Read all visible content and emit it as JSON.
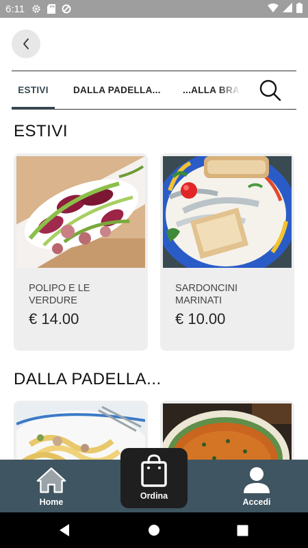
{
  "status_bar": {
    "time": "6:11",
    "icons": [
      "gear-icon",
      "sd-card-icon",
      "blocked-icon",
      "wifi-icon",
      "signal-icon",
      "battery-icon"
    ]
  },
  "header": {
    "back_icon": "chevron-left-icon"
  },
  "tabs": [
    {
      "label": "ESTIVI",
      "active": true
    },
    {
      "label": "DALLA PADELLA...",
      "active": false
    },
    {
      "label": "...ALLA BRACE",
      "active": false
    }
  ],
  "search_icon": "search-icon",
  "sections": [
    {
      "title": "ESTIVI",
      "items": [
        {
          "name": "POLIPO E LE VERDURE",
          "price": "€ 14.00"
        },
        {
          "name": "SARDONCINI MARINATI",
          "price": "€ 10.00"
        }
      ]
    },
    {
      "title": "DALLA PADELLA...",
      "items": [
        {
          "name": "",
          "price": ""
        },
        {
          "name": "",
          "price": ""
        }
      ]
    }
  ],
  "bottom_nav": {
    "home": {
      "label": "Home",
      "icon": "home-icon"
    },
    "order": {
      "label": "Ordina",
      "icon": "shopping-bag-icon"
    },
    "login": {
      "label": "Accedi",
      "icon": "user-icon"
    }
  },
  "colors": {
    "nav_bg": "#3f5561",
    "order_bg": "#1f1f1f",
    "card_bg": "#eeeeee",
    "tab_active": "#37474f"
  }
}
